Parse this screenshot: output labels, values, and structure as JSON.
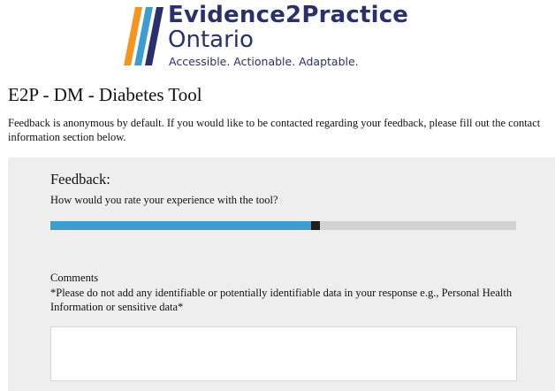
{
  "logo": {
    "brand": "Evidence2Practice",
    "region": "Ontario",
    "tagline": "Accessible. Actionable. Adaptable.",
    "colors": [
      "#f7941d",
      "#3c9dd0",
      "#2a2f6e",
      "#1b7fc1"
    ]
  },
  "page": {
    "title": "E2P - DM - Diabetes Tool",
    "intro": "Feedback is anonymous by default. If you would like to be contacted regarding your feedback, please fill out the contact information section below."
  },
  "feedback": {
    "heading": "Feedback:",
    "question": "How would you rate your experience with the tool?",
    "rating_fraction": 0.56,
    "fill_color": "#3c9dd0",
    "track_color": "#d2d2d2",
    "thumb_color": "#1f1f1f"
  },
  "comments": {
    "label": "Comments",
    "note": "*Please do not add any identifiable or potentially identifiable data in your response e.g., Personal Health Information or sensitive data*",
    "value": "",
    "scroll_up_icon": "chevron-up-icon",
    "scroll_down_icon": "chevron-down-icon"
  }
}
